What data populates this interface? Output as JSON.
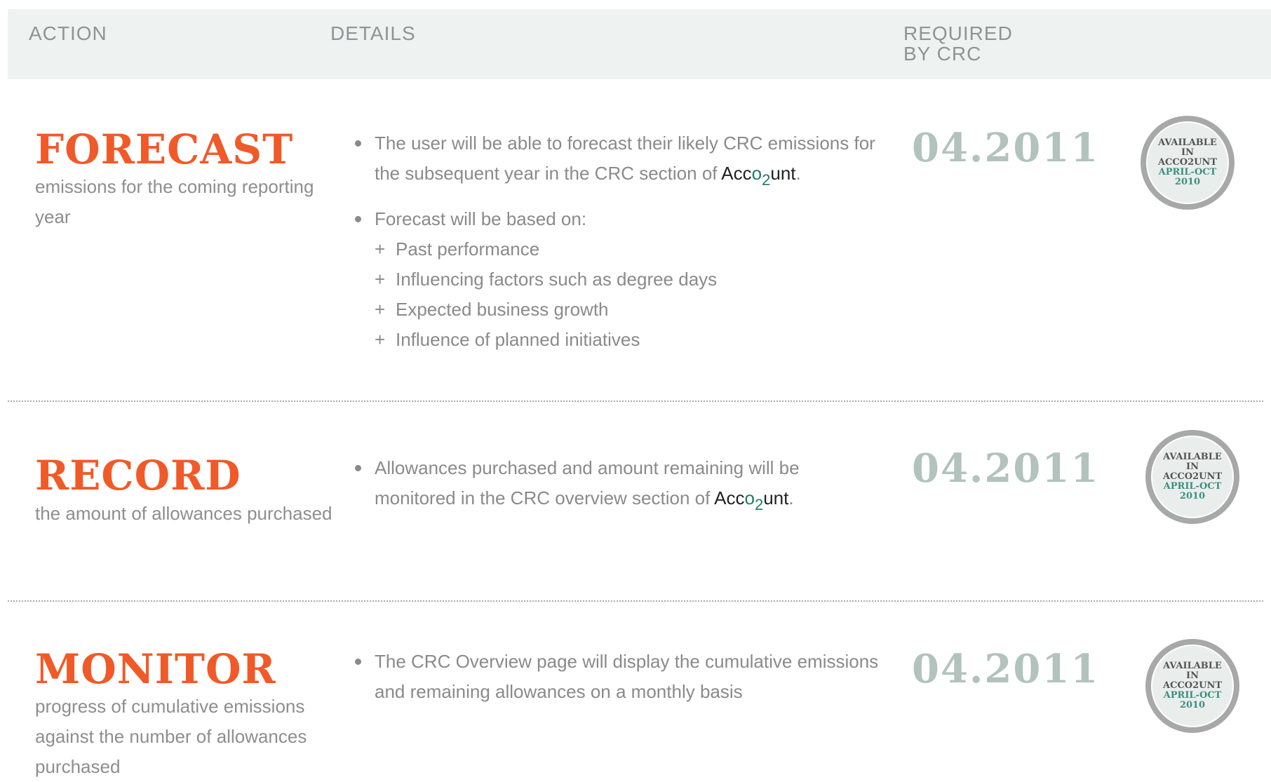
{
  "header": {
    "action": "ACTION",
    "details": "DETAILS",
    "required_line1": "REQUIRED",
    "required_line2": "BY CRC"
  },
  "brand": {
    "prefix": "Acc",
    "co": "o",
    "sub": "2",
    "suffix": "unt",
    "pre_co": "c"
  },
  "badge": {
    "line1": "AVAILABLE",
    "line2": "IN",
    "line3": "ACCO2UNT",
    "line4": "APRIL-OCT",
    "line5": "2010"
  },
  "rows": [
    {
      "title": "FORECAST",
      "subtitle": "emissions for the coming reporting year",
      "bullet1_text": "The user will be able to forecast their likely CRC emissions for the subsequent year in the CRC section of ",
      "bullet1_end": ".",
      "bullet2_text": "Forecast will be based on:",
      "items": [
        "Past performance",
        "Influencing factors such as degree days",
        "Expected business growth",
        "Influence of planned initiatives"
      ],
      "date": "04.2011"
    },
    {
      "title": "RECORD",
      "subtitle": "the amount of allowances purchased",
      "bullet1_text": "Allowances purchased and amount remaining will be monitored in the CRC overview section of ",
      "bullet1_end": ".",
      "date": "04.2011"
    },
    {
      "title": "MONITOR",
      "subtitle": "progress of cumulative emissions against the number of allowances purchased",
      "bullet1_text": "The CRC Overview page will display the cumulative emissions and remaining allowances on a monthly basis",
      "date": "04.2011"
    }
  ],
  "colors": {
    "accent": "#f05a28",
    "date": "#b2c2bc",
    "brand_green": "#1e7d6b",
    "header_bg": "#eef2f0"
  }
}
